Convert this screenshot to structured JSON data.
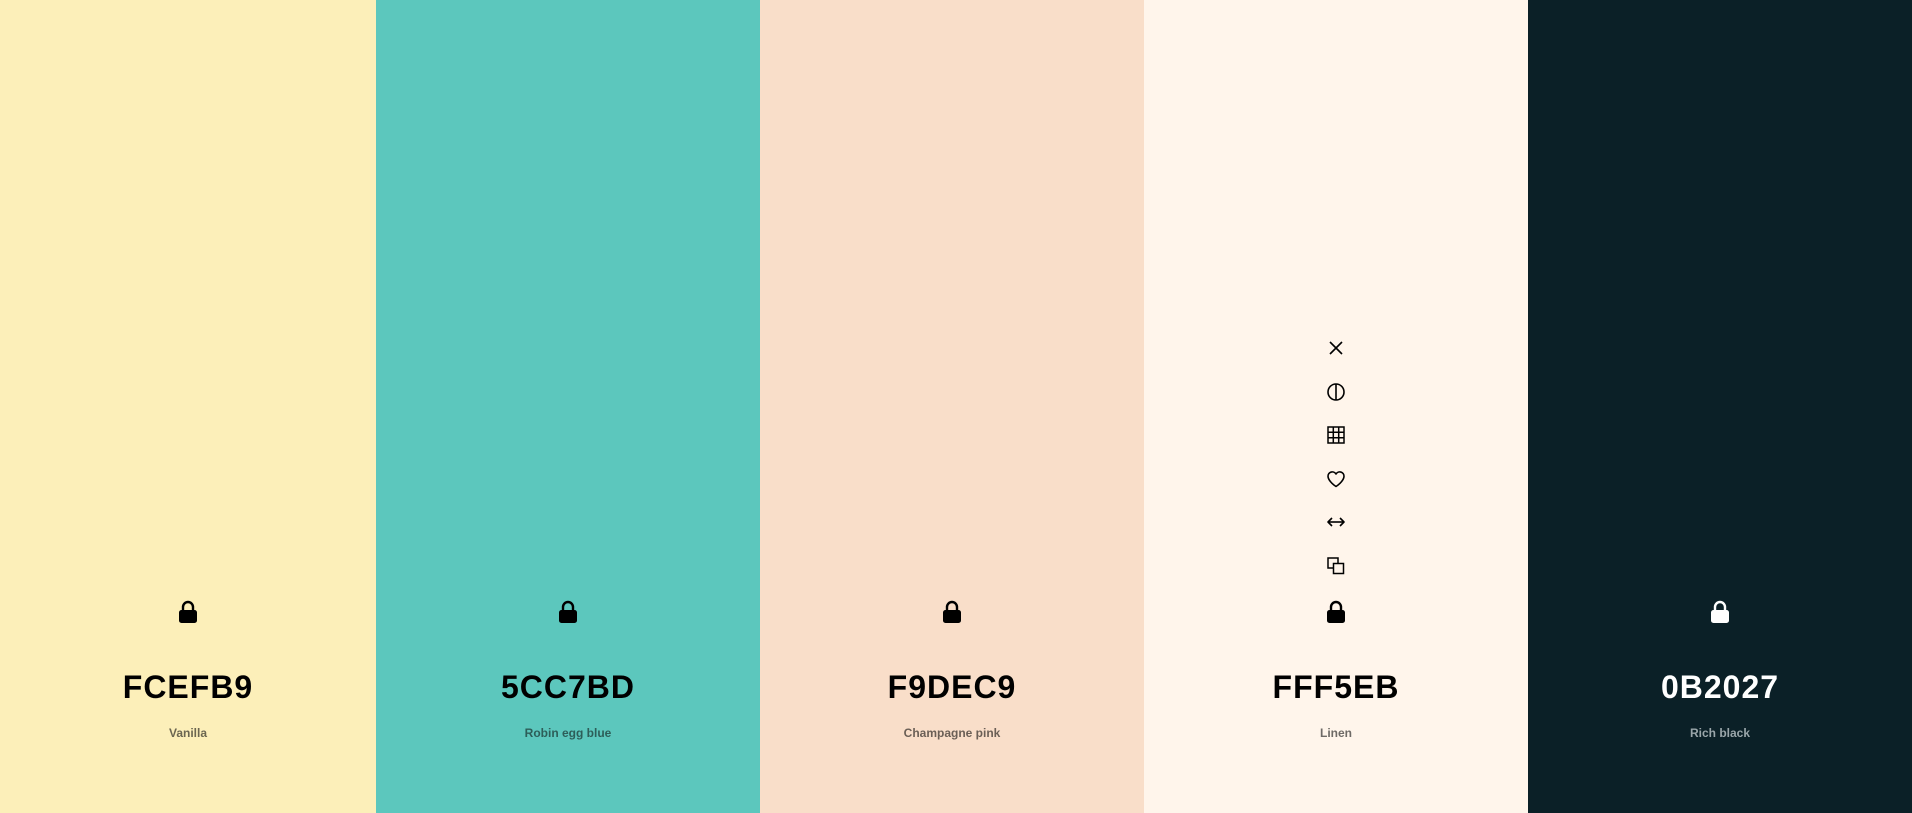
{
  "palette": {
    "swatches": [
      {
        "hex": "FCEFB9",
        "name": "Vanilla",
        "background": "#FCEFB9",
        "text_color": "#000000",
        "name_color": "#6b6650",
        "icon_color": "#000000"
      },
      {
        "hex": "5CC7BD",
        "name": "Robin egg blue",
        "background": "#5CC7BD",
        "text_color": "#000000",
        "name_color": "#2d5e59",
        "icon_color": "#000000"
      },
      {
        "hex": "F9DEC9",
        "name": "Champagne pink",
        "background": "#F9DEC9",
        "text_color": "#000000",
        "name_color": "#6b5f56",
        "icon_color": "#000000"
      },
      {
        "hex": "FFF5EB",
        "name": "Linen",
        "background": "#FFF5EB",
        "text_color": "#000000",
        "name_color": "#6e6a66",
        "icon_color": "#000000"
      },
      {
        "hex": "0B2027",
        "name": "Rich black",
        "background": "#0B2027",
        "text_color": "#FFFFFF",
        "name_color": "#9aa6aa",
        "icon_color": "#FFFFFF"
      }
    ],
    "hover_tools": {
      "swatch_index": 3,
      "icons": [
        "close-icon",
        "contrast-icon",
        "shades-grid-icon",
        "heart-icon",
        "drag-arrows-icon",
        "copy-icon"
      ]
    },
    "lock_icon": "lock-icon"
  }
}
